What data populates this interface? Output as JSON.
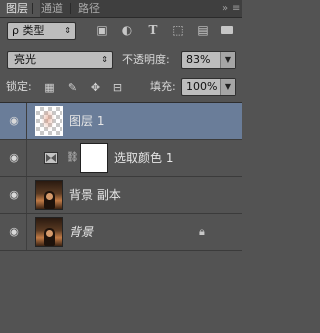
{
  "tabs": [
    {
      "label": "图层",
      "active": true
    },
    {
      "label": "通道",
      "active": false
    },
    {
      "label": "路径",
      "active": false
    }
  ],
  "panel_menu_icons": [
    "double-chevron-icon",
    "panel-menu-icon"
  ],
  "filter": {
    "kind_label": "ρ 类型",
    "icons": [
      "image-filter-icon",
      "adjustment-filter-icon",
      "type-filter-icon",
      "shape-filter-icon",
      "smart-object-filter-icon",
      "filter-toggle-icon"
    ]
  },
  "blend": {
    "mode": "亮光",
    "opacity_label": "不透明度:",
    "opacity_value": "83%"
  },
  "lock": {
    "label": "锁定:",
    "icons": [
      "lock-transparent-icon",
      "lock-image-icon",
      "lock-position-icon",
      "lock-all-icon"
    ],
    "fill_label": "填充:",
    "fill_value": "100%"
  },
  "layers": [
    {
      "name": "图层 1",
      "selected": true,
      "italic": false,
      "locked": false,
      "type": "transparent"
    },
    {
      "name": "选取颜色 1",
      "selected": false,
      "italic": false,
      "locked": false,
      "type": "adjustment"
    },
    {
      "name": "背景 副本",
      "selected": false,
      "italic": false,
      "locked": false,
      "type": "photo"
    },
    {
      "name": "背景",
      "selected": false,
      "italic": true,
      "locked": true,
      "type": "photo"
    }
  ]
}
